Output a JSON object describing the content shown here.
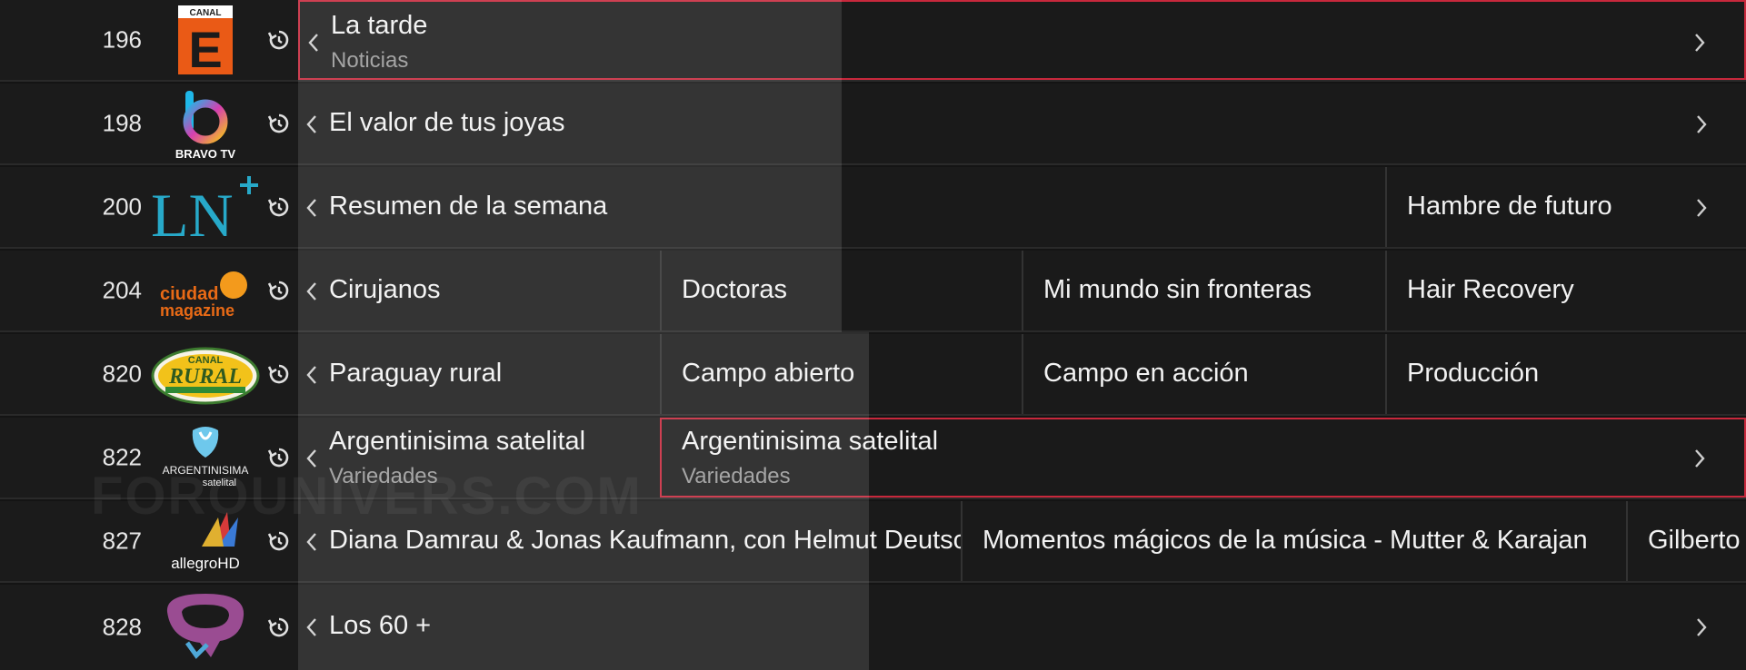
{
  "watermark": "FOROUNIVERS.COM",
  "colors": {
    "focus": "#c8283c",
    "background": "#1a1a1a"
  },
  "rows": [
    {
      "number": "196",
      "logo": {
        "name": "canal-e-logo",
        "text": "CANAL",
        "letter": "E"
      },
      "programs": [
        {
          "title": "La tarde",
          "subtitle": "Noticias",
          "focused": true
        }
      ]
    },
    {
      "number": "198",
      "logo": {
        "name": "bravo-tv-logo",
        "text": "BRAVO TV"
      },
      "programs": [
        {
          "title": "El valor de tus joyas"
        }
      ]
    },
    {
      "number": "200",
      "logo": {
        "name": "ln-plus-logo",
        "text": "LN"
      },
      "programs": [
        {
          "title": "Resumen de la semana"
        },
        {
          "title": "Hambre de futuro"
        }
      ]
    },
    {
      "number": "204",
      "logo": {
        "name": "ciudad-magazine-logo",
        "text1": "ciudad",
        "text2": "magazine"
      },
      "programs": [
        {
          "title": "Cirujanos"
        },
        {
          "title": "Doctoras"
        },
        {
          "title": "Mi mundo sin fronteras"
        },
        {
          "title": "Hair Recovery"
        }
      ]
    },
    {
      "number": "820",
      "logo": {
        "name": "canal-rural-logo",
        "text1": "CANAL",
        "text2": "RURAL"
      },
      "programs": [
        {
          "title": "Paraguay rural"
        },
        {
          "title": "Campo abierto"
        },
        {
          "title": "Campo en acción"
        },
        {
          "title": "Producción"
        }
      ]
    },
    {
      "number": "822",
      "logo": {
        "name": "argentinisima-logo",
        "text1": "ARGENTINISIMA",
        "text2": "satelital"
      },
      "programs": [
        {
          "title": "Argentinisima satelital",
          "subtitle": "Variedades"
        },
        {
          "title": "Argentinisima satelital",
          "subtitle": "Variedades",
          "focused": true
        }
      ]
    },
    {
      "number": "827",
      "logo": {
        "name": "allegro-hd-logo",
        "text": "allegroHD"
      },
      "programs": [
        {
          "title": "Diana Damrau & Jonas Kaufmann, con Helmut Deutsch"
        },
        {
          "title": "Momentos mágicos de la música - Mutter & Karajan"
        },
        {
          "title": "Gilberto"
        }
      ]
    },
    {
      "number": "828",
      "logo": {
        "name": "channel-828-logo"
      },
      "programs": [
        {
          "title": "Los 60 +"
        }
      ]
    }
  ]
}
